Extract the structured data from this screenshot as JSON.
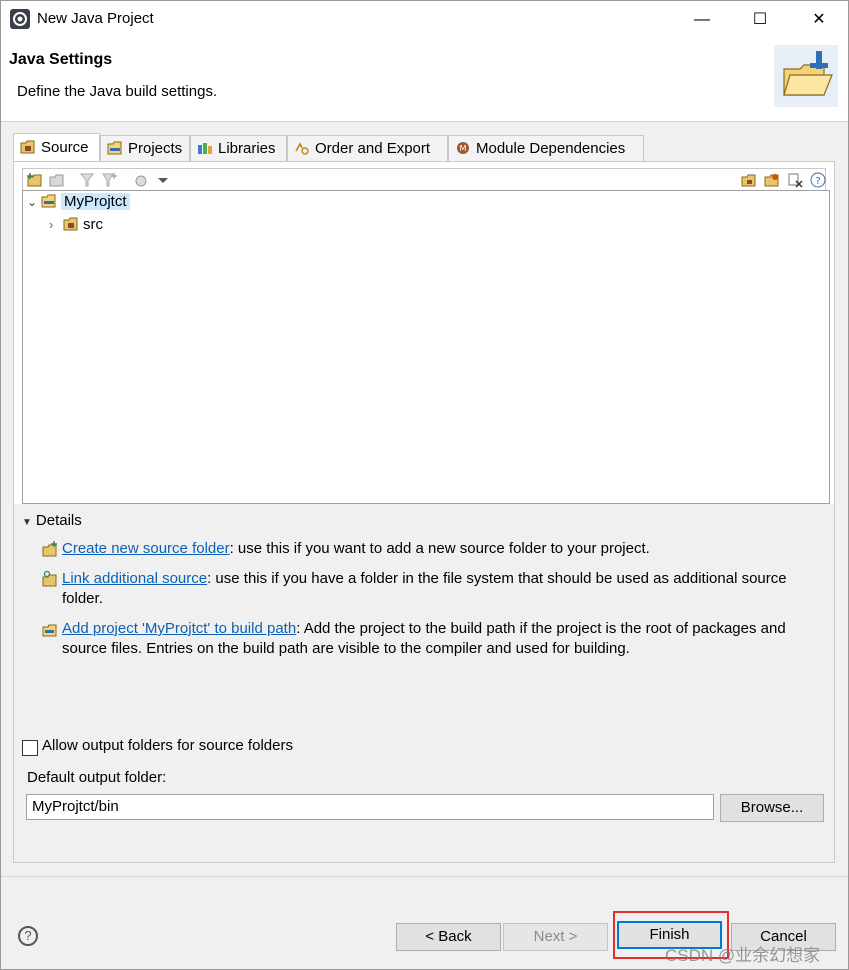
{
  "window": {
    "title": "New Java Project",
    "minimize_glyph": "—",
    "maximize_glyph": "☐",
    "close_glyph": "✕"
  },
  "header": {
    "title": "Java Settings",
    "description": "Define the Java build settings."
  },
  "tabs": [
    {
      "label": "Source",
      "icon": "source-folder-icon",
      "active": true
    },
    {
      "label": "Projects",
      "icon": "projects-icon",
      "active": false
    },
    {
      "label": "Libraries",
      "icon": "libraries-icon",
      "active": false
    },
    {
      "label": "Order and Export",
      "icon": "order-export-icon",
      "active": false
    },
    {
      "label": "Module Dependencies",
      "icon": "module-icon",
      "active": false
    }
  ],
  "tree": {
    "project": "MyProjtct",
    "children": [
      "src"
    ]
  },
  "details": {
    "heading": "Details",
    "items": [
      {
        "link": "Create new source folder",
        "text": ": use this if you want to add a new source folder to your project."
      },
      {
        "link": "Link additional source",
        "text": ": use this if you have a folder in the file system that should be used as additional source folder."
      },
      {
        "link": "Add project 'MyProjtct' to build path",
        "text": ": Add the project to the build path if the project is the root of packages and source files. Entries on the build path are visible to the compiler and used for building."
      }
    ]
  },
  "output": {
    "allow_label": "Allow output folders for source folders",
    "allow_checked": false,
    "default_label": "Default output folder:",
    "default_value": "MyProjtct/bin",
    "browse_label": "Browse..."
  },
  "footer": {
    "help_glyph": "?",
    "back_label": "< Back",
    "next_label": "Next >",
    "finish_label": "Finish",
    "cancel_label": "Cancel"
  },
  "watermark": "CSDN @业余幻想家",
  "colors": {
    "link": "#0b61b8",
    "selection": "#cce8ff",
    "highlight_box": "#e03030",
    "default_button_border": "#0078d7"
  }
}
